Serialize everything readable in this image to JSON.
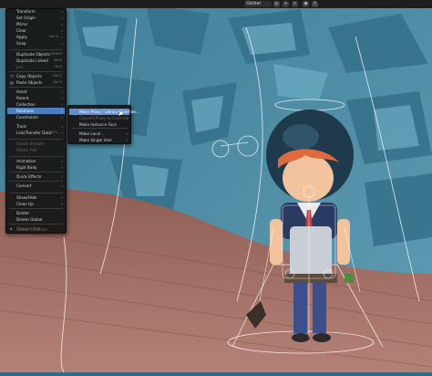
{
  "header": {
    "orientation_label": "Global",
    "icons": [
      "cursor-icon",
      "transform-orientation-icon",
      "pivot-icon",
      "snap-icon",
      "proportional-edit-icon"
    ]
  },
  "object_menu": {
    "items": [
      {
        "label": "Transform",
        "shortcut": "",
        "submenu": true
      },
      {
        "label": "Set Origin",
        "shortcut": "",
        "submenu": true
      },
      {
        "label": "Mirror",
        "shortcut": "",
        "submenu": true
      },
      {
        "label": "Clear",
        "shortcut": "",
        "submenu": true
      },
      {
        "label": "Apply",
        "shortcut": "Ctrl A",
        "submenu": true
      },
      {
        "label": "Snap",
        "shortcut": "",
        "submenu": true
      },
      {
        "label": "Duplicate Objects",
        "shortcut": "Shift D"
      },
      {
        "label": "Duplicate Linked",
        "shortcut": "Alt D"
      },
      {
        "label": "Join",
        "shortcut": "Ctrl J",
        "dim": true
      },
      {
        "label": "Copy Objects",
        "shortcut": "Ctrl C",
        "icon": "copy-icon"
      },
      {
        "label": "Paste Objects",
        "shortcut": "Ctrl V",
        "icon": "paste-icon"
      },
      {
        "label": "Asset",
        "shortcut": "",
        "submenu": true
      },
      {
        "label": "Parent",
        "shortcut": "",
        "submenu": true
      },
      {
        "label": "Collection",
        "shortcut": "",
        "submenu": true
      },
      {
        "label": "Relations",
        "shortcut": "",
        "submenu": true,
        "active": true
      },
      {
        "label": "Constraints",
        "shortcut": "",
        "submenu": true
      },
      {
        "label": "Track",
        "shortcut": "",
        "submenu": true
      },
      {
        "label": "Link/Transfer Data",
        "shortcut": "Ctrl L",
        "submenu": true
      },
      {
        "label": "Shade Smooth",
        "shortcut": "",
        "dim": true
      },
      {
        "label": "Shade Flat",
        "shortcut": "",
        "dim": true
      },
      {
        "label": "Animation",
        "shortcut": "",
        "submenu": true
      },
      {
        "label": "Rigid Body",
        "shortcut": "",
        "submenu": true
      },
      {
        "label": "Quick Effects",
        "shortcut": "",
        "submenu": true
      },
      {
        "label": "Convert",
        "shortcut": "",
        "submenu": true
      },
      {
        "label": "Show/Hide",
        "shortcut": "",
        "submenu": true
      },
      {
        "label": "Clean Up",
        "shortcut": "",
        "submenu": true
      },
      {
        "label": "Delete",
        "shortcut": ""
      },
      {
        "label": "Delete Global",
        "shortcut": ""
      },
      {
        "label": "Checker Pop",
        "shortcut": "",
        "dim": true,
        "icon": "dot-icon"
      },
      {
        "label": "Viewer De-Mesh",
        "shortcut": "",
        "dim": true,
        "icon": "dot-icon"
      }
    ]
  },
  "relations_submenu": {
    "items": [
      {
        "label": "Make Proxy / Library Override...",
        "hover": true
      },
      {
        "label": "Convert Proxy to Override",
        "dim": true
      },
      {
        "label": "Make Instance Face"
      },
      {
        "label": "Make Local...",
        "submenu": true
      },
      {
        "label": "Make Single User",
        "submenu": true
      }
    ]
  },
  "colors": {
    "menu_bg": "#181818",
    "highlight": "#4c7fbf",
    "rock": "#4a8aa3",
    "ground": "#9d6a5f",
    "helmet": "#1f3a4d",
    "hair": "#e06a3f",
    "skin": "#f2c39c",
    "overlay": "#ffffff"
  }
}
